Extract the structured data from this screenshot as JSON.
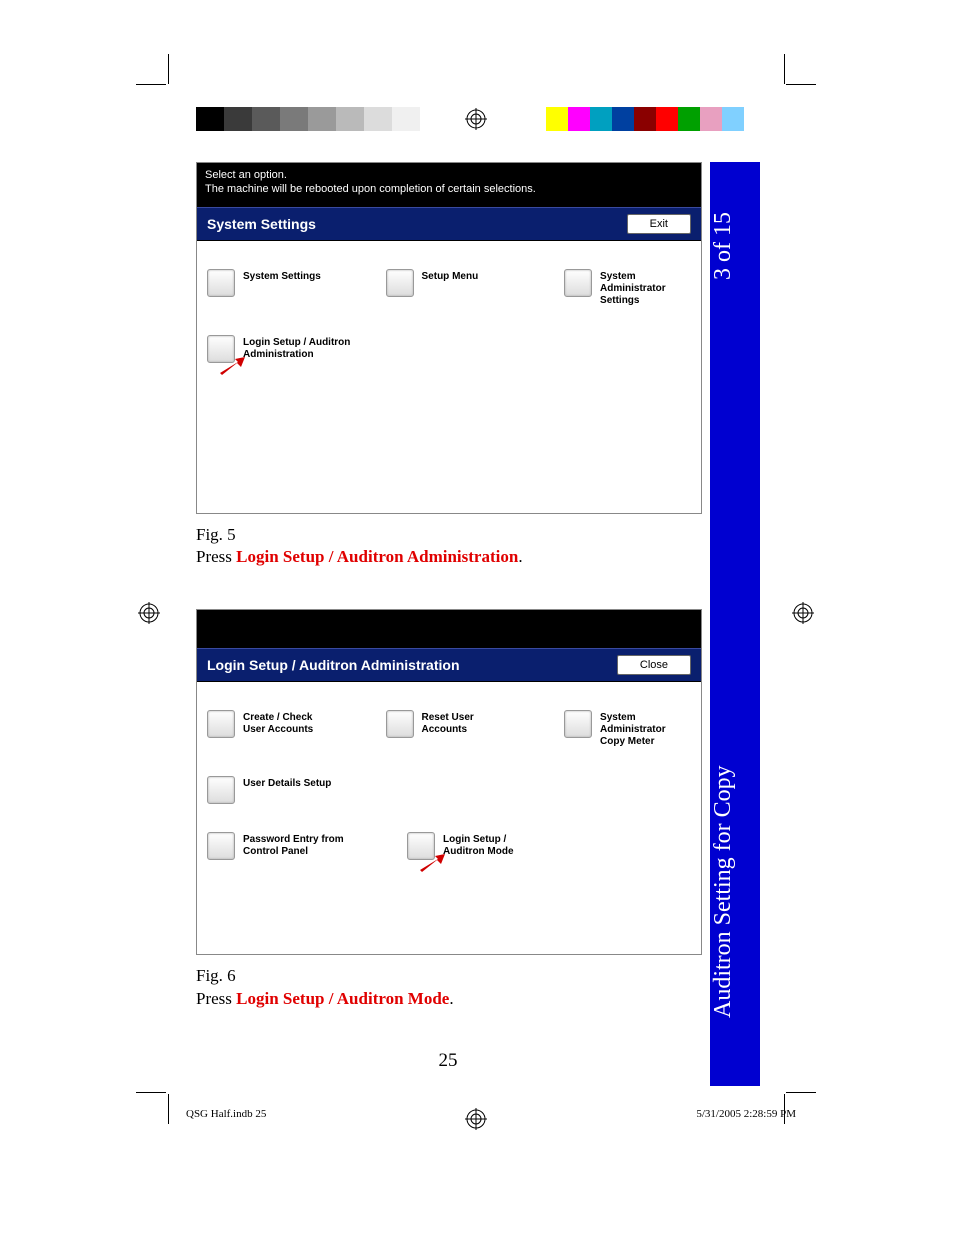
{
  "page_counter": "3 of 15",
  "section_title": "Auditron Setting for Copy",
  "page_number": "25",
  "footer_left": "QSG Half.indb   25",
  "footer_right": "5/31/2005   2:28:59 PM",
  "fig5": {
    "banner_line1": "Select an option.",
    "banner_line2": "The machine will be rebooted upon completion of certain selections.",
    "title": "System Settings",
    "close_btn": "Exit",
    "opts": {
      "r1c1": "System Settings",
      "r1c2": "Setup Menu",
      "r1c3": "System Administrator Settings",
      "r2c1": "Login Setup / Auditron Administration"
    },
    "caption_fig": "Fig. 5",
    "caption_press": "Press ",
    "caption_target": "Login Setup / Auditron Administration",
    "caption_end": "."
  },
  "fig6": {
    "title": "Login Setup / Auditron Administration",
    "close_btn": "Close",
    "opts": {
      "r1c1": "Create / Check User Accounts",
      "r1c2": "Reset User Accounts",
      "r1c3": "System Administrator Copy Meter",
      "r2c1": "User Details Setup",
      "r3c1": "Password Entry from Control Panel",
      "r3c2": "Login Setup / Auditron Mode"
    },
    "caption_fig": "Fig. 6",
    "caption_press": "Press ",
    "caption_target": "Login Setup / Auditron Mode",
    "caption_end": "."
  },
  "calbars": {
    "left": [
      "#000000",
      "#3a3a3a",
      "#5a5a5a",
      "#7a7a7a",
      "#9a9a9a",
      "#bababa",
      "#dcdcdc",
      "#f0f0f0"
    ],
    "right": [
      "#ffff00",
      "#ff00ff",
      "#00a0c0",
      "#0040a0",
      "#8a0000",
      "#ff0000",
      "#00a000",
      "#e8a0c0",
      "#80d0ff"
    ]
  }
}
